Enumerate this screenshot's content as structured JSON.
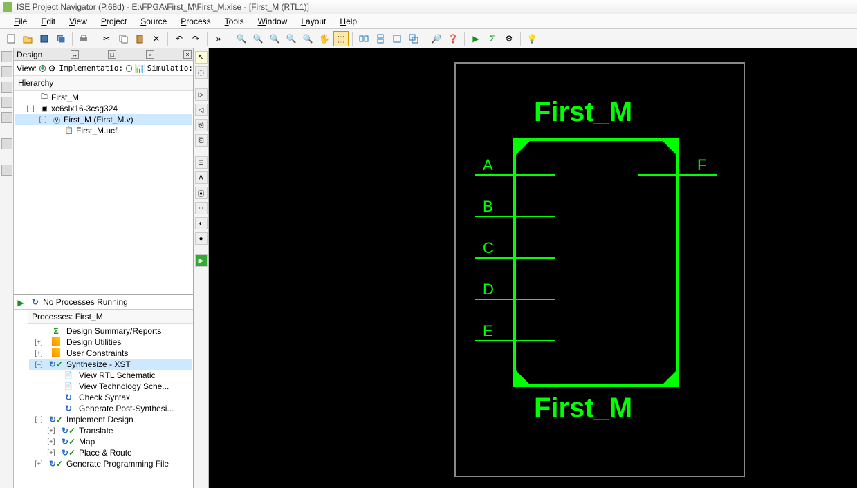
{
  "title": "ISE Project Navigator (P.68d) - E:\\FPGA\\First_M\\First_M.xise - [First_M (RTL1)]",
  "menu": [
    "File",
    "Edit",
    "View",
    "Project",
    "Source",
    "Process",
    "Tools",
    "Window",
    "Layout",
    "Help"
  ],
  "design": {
    "panel_title": "Design",
    "view_label": "View:",
    "impl_label": "Implementatio:",
    "sim_label": "Simulatio:",
    "hierarchy_label": "Hierarchy",
    "tree": [
      {
        "indent": 0,
        "icon": "proj",
        "label": "First_M"
      },
      {
        "indent": 0,
        "icon": "chip",
        "label": "xc6slx16-3csg324",
        "expand": "–"
      },
      {
        "indent": 1,
        "icon": "vmod",
        "label": "First_M (First_M.v)",
        "expand": "–",
        "sel": true
      },
      {
        "indent": 2,
        "icon": "ucf",
        "label": "First_M.ucf"
      }
    ]
  },
  "processes": {
    "running_label": "No Processes Running",
    "header": "Processes: First_M",
    "tree": [
      {
        "indent": 0,
        "icon": "sigma",
        "label": "Design Summary/Reports"
      },
      {
        "indent": 0,
        "icon": "wand",
        "label": "Design Utilities",
        "expand": "+"
      },
      {
        "indent": 0,
        "icon": "wand",
        "label": "User Constraints",
        "expand": "+"
      },
      {
        "indent": 0,
        "icon": "cycle-ok",
        "label": "Synthesize - XST",
        "expand": "–",
        "sel": true
      },
      {
        "indent": 1,
        "icon": "doc",
        "label": "View RTL Schematic"
      },
      {
        "indent": 1,
        "icon": "doc",
        "label": "View Technology Sche..."
      },
      {
        "indent": 1,
        "icon": "cycle",
        "label": "Check Syntax"
      },
      {
        "indent": 1,
        "icon": "cycle",
        "label": "Generate Post-Synthesi..."
      },
      {
        "indent": 0,
        "icon": "cycle-ok",
        "label": "Implement Design",
        "expand": "–"
      },
      {
        "indent": 1,
        "icon": "cycle-ok",
        "label": "Translate",
        "expand": "+"
      },
      {
        "indent": 1,
        "icon": "cycle-ok",
        "label": "Map",
        "expand": "+"
      },
      {
        "indent": 1,
        "icon": "cycle-ok",
        "label": "Place & Route",
        "expand": "+"
      },
      {
        "indent": 0,
        "icon": "cycle-ok",
        "label": "Generate Programming File",
        "expand": "+"
      }
    ]
  },
  "schematic": {
    "module_name_top": "First_M",
    "module_name_bottom": "First_M",
    "inputs": [
      "A",
      "B",
      "C",
      "D",
      "E"
    ],
    "outputs": [
      "F"
    ]
  }
}
